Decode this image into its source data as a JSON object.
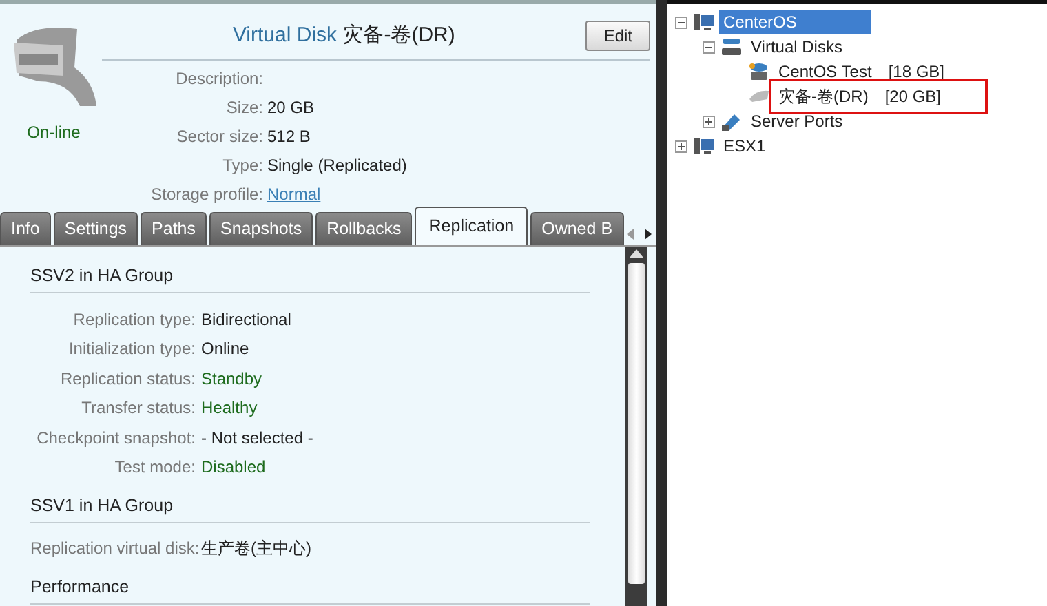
{
  "disk": {
    "title_prefix": "Virtual Disk",
    "title_name": "灾备-卷(DR)",
    "edit_button": "Edit",
    "status": "On-line",
    "properties": [
      {
        "label": "Description:"
      },
      {
        "label": "Size:",
        "value": "20 GB",
        "kind": "text"
      },
      {
        "label": "Sector size:",
        "value": "512 B",
        "kind": "text"
      },
      {
        "label": "Type:",
        "value": "Single (Replicated)",
        "kind": "text"
      },
      {
        "label": "Storage profile:",
        "value": "Normal",
        "kind": "link"
      }
    ]
  },
  "tabs": [
    {
      "label": "Info",
      "selected": false
    },
    {
      "label": "Settings",
      "selected": false
    },
    {
      "label": "Paths",
      "selected": false
    },
    {
      "label": "Snapshots",
      "selected": false
    },
    {
      "label": "Rollbacks",
      "selected": false
    },
    {
      "label": "Replication",
      "selected": true
    },
    {
      "label": "Owned B",
      "selected": false
    }
  ],
  "sections": [
    {
      "title": "SSV2 in HA Group",
      "rows": [
        {
          "label": "Replication type:",
          "value": "Bidirectional",
          "color": "#222222"
        },
        {
          "label": "Initialization type:",
          "value": "Online",
          "color": "#222222"
        },
        {
          "label": "Replication status:",
          "value": "Standby",
          "color": "#1d6b1d"
        },
        {
          "label": "Transfer status:",
          "value": "Healthy",
          "color": "#1d6b1d"
        },
        {
          "label": "Checkpoint snapshot:",
          "value": "- Not selected -",
          "color": "#222222"
        },
        {
          "label": "Test mode:",
          "value": "Disabled",
          "color": "#1d6b1d"
        }
      ]
    },
    {
      "title": "SSV1 in HA Group",
      "rows": [
        {
          "label": "Replication virtual disk:",
          "value": "生产卷(主中心)",
          "color": "#222222"
        }
      ]
    },
    {
      "title": "Performance"
    }
  ],
  "tree": [
    {
      "label": "CenterOS",
      "kind": "server",
      "selected": true,
      "expanded": true,
      "children": [
        {
          "label": "Virtual Disks",
          "kind": "disks",
          "selected": false,
          "expanded": true,
          "children": [
            {
              "label": "CentOS Test",
              "size": "[18 GB]",
              "kind": "disk",
              "selected": false
            },
            {
              "label": "灾备-卷(DR)",
              "size": "[20 GB]",
              "kind": "ghost",
              "selected": false,
              "highlighted": true
            }
          ]
        },
        {
          "label": "Server Ports",
          "kind": "ports",
          "selected": false,
          "expanded": false
        }
      ]
    },
    {
      "label": "ESX1",
      "kind": "server",
      "selected": false,
      "expanded": false
    }
  ]
}
